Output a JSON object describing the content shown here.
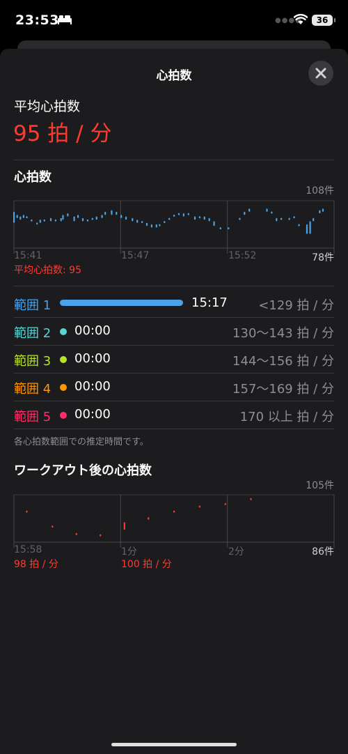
{
  "status": {
    "time": "23:53",
    "battery": "36"
  },
  "sheet": {
    "title": "心拍数"
  },
  "average": {
    "label": "平均心拍数",
    "value": "95 拍 / 分"
  },
  "hr_section": {
    "title": "心拍数",
    "ymax": "108件",
    "ymin": "78件",
    "x_labels": [
      "15:41",
      "15:47",
      "15:52"
    ],
    "avg_text": "平均心拍数: 95"
  },
  "zones": [
    {
      "name": "範囲 1",
      "duration": "15:17",
      "range": "<129 拍 / 分",
      "color": "#4aa3e8"
    },
    {
      "name": "範囲 2",
      "duration": "00:00",
      "range": "130～143 拍 / 分",
      "color": "#5ad4d4"
    },
    {
      "name": "範囲 3",
      "duration": "00:00",
      "range": "144～156 拍 / 分",
      "color": "#b7e22e"
    },
    {
      "name": "範囲 4",
      "duration": "00:00",
      "range": "157～169 拍 / 分",
      "color": "#ff9500"
    },
    {
      "name": "範囲 5",
      "duration": "00:00",
      "range": "170 以上 拍 / 分",
      "color": "#ff2d6a"
    }
  ],
  "zone_note": "各心拍数範囲での推定時間です。",
  "post_section": {
    "title": "ワークアウト後の心拍数",
    "ymax": "105件",
    "ymin": "86件",
    "x_labels": [
      "15:58",
      "1分",
      "2分"
    ],
    "sub_labels": [
      "98 拍 / 分",
      "100 拍 / 分"
    ]
  },
  "chart_data": [
    {
      "type": "scatter",
      "title": "心拍数",
      "ylim": [
        78,
        108
      ],
      "x_ticks": [
        "15:41",
        "15:47",
        "15:52"
      ],
      "color": "#4aa3e8",
      "segments": [
        [
          0.0,
          94,
          101
        ],
        [
          1.0,
          97,
          99
        ],
        [
          2.0,
          96,
          98
        ],
        [
          3.0,
          97,
          99
        ],
        [
          4.0,
          97,
          98
        ],
        [
          5.5,
          95,
          96
        ],
        [
          7.2,
          93,
          94
        ],
        [
          8.2,
          94,
          96
        ],
        [
          9.5,
          95,
          96
        ],
        [
          11.5,
          95,
          97
        ],
        [
          13.0,
          95,
          96
        ],
        [
          14.7,
          95,
          97
        ],
        [
          15.3,
          96,
          99
        ],
        [
          16.8,
          98,
          100
        ],
        [
          18.8,
          95,
          98
        ],
        [
          20.0,
          97,
          99
        ],
        [
          21.5,
          95,
          97
        ],
        [
          23.0,
          95,
          96
        ],
        [
          24.5,
          96,
          97
        ],
        [
          25.8,
          96,
          98
        ],
        [
          27.5,
          97,
          99
        ],
        [
          28.5,
          99,
          101
        ],
        [
          30.5,
          99,
          102
        ],
        [
          32.0,
          99,
          101
        ],
        [
          33.5,
          97,
          99
        ],
        [
          35.0,
          96,
          98
        ],
        [
          37.0,
          95,
          97
        ],
        [
          38.5,
          94,
          96
        ],
        [
          40.0,
          94,
          95
        ],
        [
          41.5,
          92,
          94
        ],
        [
          43.0,
          91,
          93
        ],
        [
          44.5,
          91,
          93
        ],
        [
          45.5,
          92,
          93
        ],
        [
          47.0,
          94,
          95
        ],
        [
          48.5,
          96,
          97
        ],
        [
          50.0,
          98,
          99
        ],
        [
          51.5,
          99,
          100
        ],
        [
          53.0,
          98,
          100
        ],
        [
          54.5,
          99,
          100
        ],
        [
          56.5,
          96,
          98
        ],
        [
          58.0,
          97,
          98
        ],
        [
          59.5,
          96,
          98
        ],
        [
          61.0,
          95,
          97
        ],
        [
          62.5,
          92,
          95
        ],
        [
          64.5,
          90,
          91
        ],
        [
          67.0,
          90,
          91
        ],
        [
          70.5,
          96,
          97
        ],
        [
          72.0,
          99,
          101
        ],
        [
          73.5,
          101,
          103
        ],
        [
          79.0,
          101,
          103
        ],
        [
          80.5,
          100,
          101
        ],
        [
          82.0,
          95,
          97
        ],
        [
          83.5,
          96,
          97
        ],
        [
          86.0,
          96,
          97
        ],
        [
          87.5,
          97,
          98
        ],
        [
          89.0,
          92,
          93
        ],
        [
          91.5,
          87,
          93
        ],
        [
          92.5,
          87,
          95
        ],
        [
          93.5,
          95,
          97
        ],
        [
          95.5,
          100,
          102
        ],
        [
          96.5,
          101,
          103
        ]
      ]
    },
    {
      "type": "scatter",
      "title": "ワークアウト後の心拍数",
      "ylim": [
        86,
        105
      ],
      "x_ticks": [
        "15:58",
        "1分",
        "2分"
      ],
      "color": "#ff3b30",
      "segments": [
        [
          4.0,
          98,
          98.5
        ],
        [
          12.0,
          92,
          92.5
        ],
        [
          19.5,
          89,
          89.5
        ],
        [
          27.0,
          88.5,
          89
        ],
        [
          34.5,
          91,
          94
        ],
        [
          42.0,
          95,
          96
        ],
        [
          50.0,
          98,
          98.5
        ],
        [
          58.0,
          100,
          100.5
        ],
        [
          66.0,
          101,
          101.5
        ],
        [
          74.0,
          103,
          103.5
        ]
      ]
    }
  ]
}
